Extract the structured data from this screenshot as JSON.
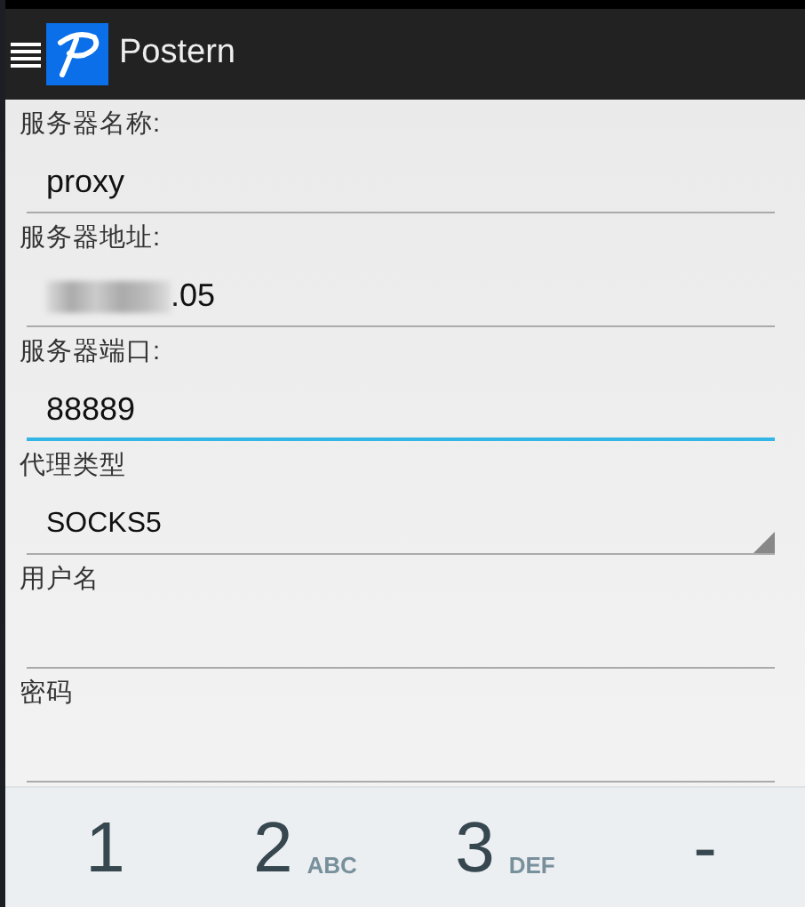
{
  "app_bar": {
    "title": "Postern"
  },
  "fields": [
    {
      "kind": "text",
      "label": "服务器名称:",
      "value": "proxy",
      "focused": false,
      "redacted": false
    },
    {
      "kind": "text",
      "label": "服务器地址:",
      "value": ".05",
      "focused": false,
      "redacted": true
    },
    {
      "kind": "text",
      "label": "服务器端口:",
      "value": "88889",
      "focused": true,
      "redacted": false
    },
    {
      "kind": "spinner",
      "label": "代理类型",
      "value": "SOCKS5"
    },
    {
      "kind": "text",
      "label": "用户名",
      "focused": false,
      "redacted": false
    },
    {
      "kind": "text",
      "label": "密码",
      "focused": false,
      "redacted": false
    }
  ],
  "keyboard": {
    "keys": [
      {
        "main": "1"
      },
      {
        "main": "2",
        "letters": "ABC"
      },
      {
        "main": "3",
        "letters": "DEF"
      },
      {
        "main": "-"
      }
    ]
  }
}
